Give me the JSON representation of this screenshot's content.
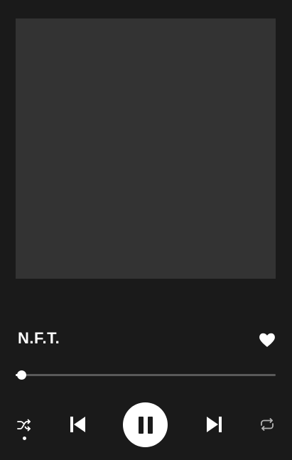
{
  "track": {
    "title": "N.F.T.",
    "liked": true
  },
  "playback": {
    "progress": 0.022,
    "state": "playing",
    "shuffle": true,
    "repeat": false
  },
  "icons": {
    "like": "heart-icon",
    "shuffle": "shuffle-icon",
    "previous": "skip-previous-icon",
    "play_pause": "pause-icon",
    "next": "skip-next-icon",
    "repeat": "repeat-icon"
  },
  "colors": {
    "background": "#1a1a1a",
    "artwork_placeholder": "#333333",
    "foreground": "#ffffff",
    "progress_track": "#5a5a5a",
    "inactive_icon": "#b3b3b3"
  }
}
